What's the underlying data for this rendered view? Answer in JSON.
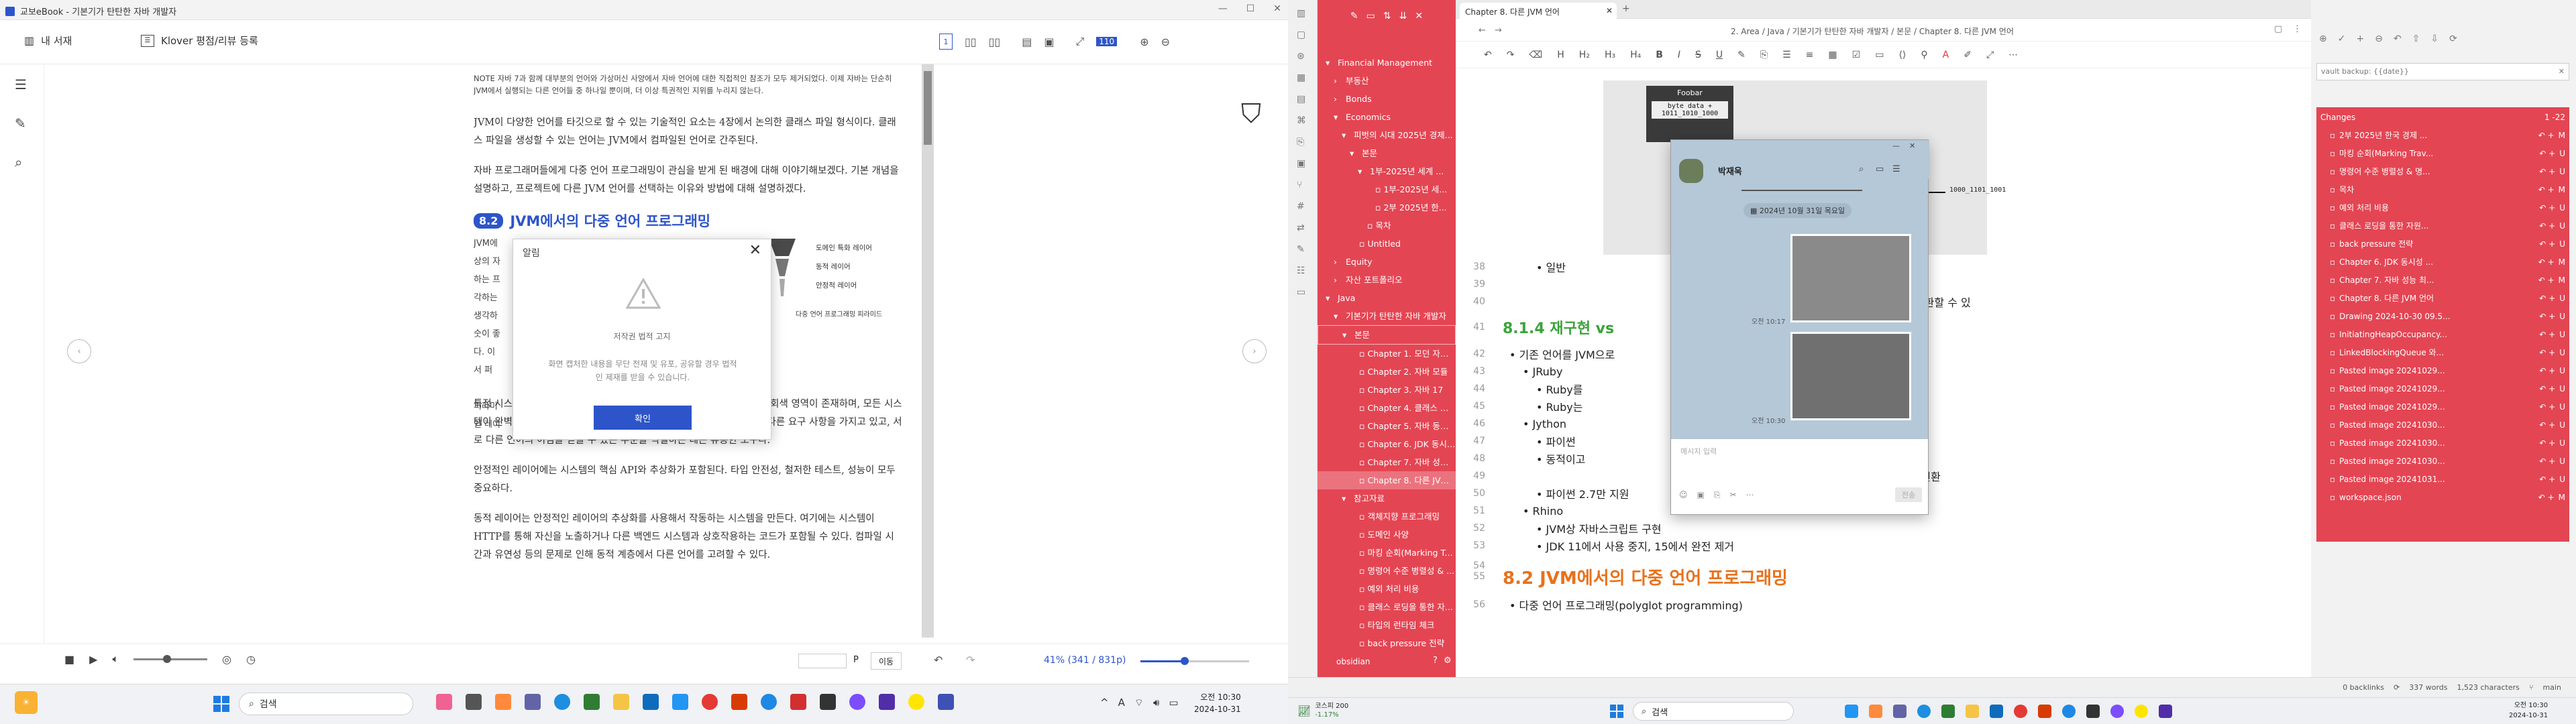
{
  "ebook": {
    "window_title": "교보eBook - 기본기가 탄탄한 자바 개발자",
    "toolbar": {
      "my_library": "내 서재",
      "klover_label": "Klover 평점/리뷰 등록",
      "zoom_value": "110"
    },
    "page": {
      "note_box": "NOTE 자바 7과 함께 대부분의 언어와 가상머신 사양에서 자바 언어에 대한 직접적인 참조가 모두 제거되었다. 이제 자바는 단순히 JVM에서 실행되는 다른 언어들 중 하나일 뿐이며, 더 이상 특권적인 지위를 누리지 않는다.",
      "p1": "JVM이 다양한 언어를 타깃으로 할 수 있는 기술적인 요소는 4장에서 논의한 클래스 파일 형식이다. 클래스 파일을 생성할 수 있는 언어는 JVM에서 컴파일된 언어로 간주된다.",
      "p2": "자바 프로그래머들에게 다중 언어 프로그래밍이 관심을 받게 된 배경에 대해 이야기해보겠다. 기본 개념을 설명하고, 프로젝트에 다른 JVM 언어를 선택하는 이유와 방법에 대해 설명하겠다.",
      "section_num": "8.2",
      "section_title": "JVM에서의 다중 언어 프로그래밍",
      "fig_labels": [
        "도메인 특화 레이어",
        "동적 레이어",
        "안정적 레이어"
      ],
      "fig_caption": "다중 언어 프로그래밍 피라미드",
      "p3": "특정 시스템에서 이러한 레이어를 정의하는 것은 항상 쉽지 않을 수 있다. 회색 영역이 존재하며, 모든 시스템이 완벽하게 맞지는 않는다. 그러나 이것은 시스템의 다른 부분이 서로 다른 요구 사항을 가지고 있고, 서로 다른 언어의 이점을 얻을 수 있는 부분을 식별하는 데는 유용한 도구다.",
      "p4": "안정적인 레이어에는 시스템의 핵심 API와 추상화가 포함된다. 타입 안전성, 철저한 테스트, 성능이 모두 중요하다.",
      "p5": "동적 레이어는 안정적인 레이어의 추상화를 사용해서 작동하는 시스템을 만든다. 여기에는 시스템이 HTTP를 통해 자신을 노출하거나 다른 백엔드 시스템과 상호작용하는 코드가 포함될 수 있다. 컴파일 시간과 유연성 등의 문제로 인해 동적 계층에서 다른 언어를 고려할 수 있다."
    },
    "dialog": {
      "title": "알림",
      "heading": "저작권 법적 고지",
      "body": "화면 캡처한 내용을 무단 전재 및 유포, 공유할 경우 법적인 제재를 받을 수 있습니다.",
      "confirm": "확인"
    },
    "bottom": {
      "page_unit": "P",
      "go": "이동",
      "progress": "41% (341 / 831p)",
      "progress_fraction": 0.41
    }
  },
  "obsidian": {
    "tab_title": "Chapter 8. 다른 JVM 언어",
    "breadcrumb": "2. Area / Java / 기본기가 탄탄한 자바 개발자 / 본문 / Chapter 8. 다른 JVM 언어",
    "files": [
      {
        "label": "Financial Management",
        "indent": 1,
        "arrow": "▾"
      },
      {
        "label": "부동산",
        "indent": 2,
        "arrow": "›"
      },
      {
        "label": "Bonds",
        "indent": 2,
        "arrow": "›"
      },
      {
        "label": "Economics",
        "indent": 2,
        "arrow": "▾"
      },
      {
        "label": "피벗의 시대 2025년 경제...",
        "indent": 3,
        "arrow": "▾"
      },
      {
        "label": "본문",
        "indent": 4,
        "arrow": "▾"
      },
      {
        "label": "1부-2025년 세계 ...",
        "indent": 5,
        "arrow": "▾"
      },
      {
        "label": "1부-2025년 세...",
        "indent": 6,
        "arrow": ""
      },
      {
        "label": "2부 2025년 한...",
        "indent": 6,
        "arrow": ""
      },
      {
        "label": "목차",
        "indent": 5,
        "arrow": ""
      },
      {
        "label": "Untitled",
        "indent": 4,
        "arrow": ""
      },
      {
        "label": "Equity",
        "indent": 2,
        "arrow": "›"
      },
      {
        "label": "자산 포트폴리오",
        "indent": 2,
        "arrow": "›"
      },
      {
        "label": "Java",
        "indent": 1,
        "arrow": "▾"
      },
      {
        "label": "기본기가 탄탄한 자바 개발자",
        "indent": 2,
        "arrow": "▾"
      },
      {
        "label": "본문",
        "indent": 3,
        "arrow": "▾"
      },
      {
        "label": "Chapter 1. 모던 자바 ...",
        "indent": 4,
        "arrow": ""
      },
      {
        "label": "Chapter 2. 자바 모듈",
        "indent": 4,
        "arrow": ""
      },
      {
        "label": "Chapter 3. 자바 17",
        "indent": 4,
        "arrow": ""
      },
      {
        "label": "Chapter 4. 클래스 파...",
        "indent": 4,
        "arrow": ""
      },
      {
        "label": "Chapter 5. 자바 동시...",
        "indent": 4,
        "arrow": ""
      },
      {
        "label": "Chapter 6. JDK 동시성...",
        "indent": 4,
        "arrow": ""
      },
      {
        "label": "Chapter 7. 자바 성능 ...",
        "indent": 4,
        "arrow": ""
      },
      {
        "label": "Chapter 8. 다른 JVM ...",
        "indent": 4,
        "arrow": ""
      },
      {
        "label": "참고자료",
        "indent": 3,
        "arrow": "▾"
      },
      {
        "label": "객체지향 프로그래밍",
        "indent": 4,
        "arrow": ""
      },
      {
        "label": "도메인 사양",
        "indent": 4,
        "arrow": ""
      },
      {
        "label": "마킹 순회(Marking Tra...",
        "indent": 4,
        "arrow": ""
      },
      {
        "label": "명령어 수준 병렬성 & ...",
        "indent": 4,
        "arrow": ""
      },
      {
        "label": "예외 처리 비용",
        "indent": 4,
        "arrow": ""
      },
      {
        "label": "클래스 로딩을 통한 자...",
        "indent": 4,
        "arrow": ""
      },
      {
        "label": "타입의 런타임 체크",
        "indent": 4,
        "arrow": ""
      },
      {
        "label": "back pressure 전략",
        "indent": 4,
        "arrow": ""
      }
    ],
    "vault_name": "obsidian",
    "editor": {
      "fig_box_title": "Foobar",
      "fig_box_body": "byte data +\n1011_1010_1000",
      "fig_output": "1000_1101_1001",
      "line38": "• 일반",
      "line40_tail": "수로부터 반환할 수 있",
      "heading_814": "8.1.4 재구현 vs",
      "l42": "• 기존 언어를 JVM으로",
      "l43": "• JRuby",
      "l44": "• Ruby를",
      "l45": "• Ruby는",
      "l46": "• Jython",
      "l47": "• 파이썬",
      "l48": "• 동적이고",
      "l49": "• 내부적으로 파이썬 코드를 자바 바이트코드로 변환",
      "l49_tail": "바이트코드로 변환",
      "l50": "• 파이썬 2.7만 지원",
      "l51": "• Rhino",
      "l52": "• JVM상 자바스크립트 구현",
      "l53": "• JDK 11에서 사용 중지, 15에서 완전 제거",
      "heading_82": "8.2 JVM에서의 다중 언어 프로그래밍",
      "l55": "• 다중 언어 프로그래밍(polyglot programming)",
      "line_numbers": [
        "38",
        "39",
        "40",
        "41",
        "42",
        "43",
        "44",
        "45",
        "46",
        "47",
        "48",
        "49",
        "50",
        "51",
        "52",
        "53",
        "54",
        "55",
        "56"
      ]
    },
    "changes": {
      "search": "vault backup: {{date}}",
      "title": "Changes",
      "count": "1 -22",
      "items": [
        {
          "name": "2부 2025년 한국 경제 ...",
          "flag": "M"
        },
        {
          "name": "마킹 순회(Marking Trav...",
          "flag": "U"
        },
        {
          "name": "명령어 수준 병렬성 & 명...",
          "flag": "U"
        },
        {
          "name": "목차",
          "flag": "M"
        },
        {
          "name": "예외 처리 비용",
          "flag": "U"
        },
        {
          "name": "클래스 로딩을 통한 자원...",
          "flag": "U"
        },
        {
          "name": "back pressure 전략",
          "flag": "U"
        },
        {
          "name": "Chapter 6. JDK 동시성 ...",
          "flag": "M"
        },
        {
          "name": "Chapter 7. 자바 성능 최...",
          "flag": "M"
        },
        {
          "name": "Chapter 8. 다른 JVM 언어",
          "flag": "U"
        },
        {
          "name": "Drawing 2024-10-30 09.5...",
          "flag": "U"
        },
        {
          "name": "InitiatingHeapOccupancy...",
          "flag": "U"
        },
        {
          "name": "LinkedBlockingQueue 와...",
          "flag": "U"
        },
        {
          "name": "Pasted image 20241029...",
          "flag": "U"
        },
        {
          "name": "Pasted image 20241029...",
          "flag": "U"
        },
        {
          "name": "Pasted image 20241029...",
          "flag": "U"
        },
        {
          "name": "Pasted image 20241030...",
          "flag": "U"
        },
        {
          "name": "Pasted image 20241030...",
          "flag": "U"
        },
        {
          "name": "Pasted image 20241030...",
          "flag": "U"
        },
        {
          "name": "Pasted image 20241031...",
          "flag": "U"
        },
        {
          "name": "workspace.json",
          "flag": "M"
        }
      ]
    },
    "status": {
      "backlinks": "0 backlinks",
      "words": "337 words",
      "chars": "1,523 characters",
      "branch": "main"
    }
  },
  "chat": {
    "name": "박재욱",
    "date": "2024년 10월 31일 목요일",
    "times": [
      "오전 10:17",
      "오전 10:30"
    ],
    "input_placeholder": "메시지 입력",
    "send": "전송"
  },
  "taskbar_left": {
    "weather": "",
    "search": "검색",
    "time": "오전 10:30",
    "date": "2024-10-31"
  },
  "taskbar_right": {
    "stock_name": "코스피",
    "stock_value": "200",
    "stock_change": "-1.17%",
    "search": "검색",
    "time": "오전 10:30",
    "date": "2024-10-31"
  },
  "colors": {
    "obs_red": "#e44553",
    "accent_blue": "#2d55c9",
    "heading_orange": "#e8721c",
    "heading_green": "#3aa33a"
  }
}
